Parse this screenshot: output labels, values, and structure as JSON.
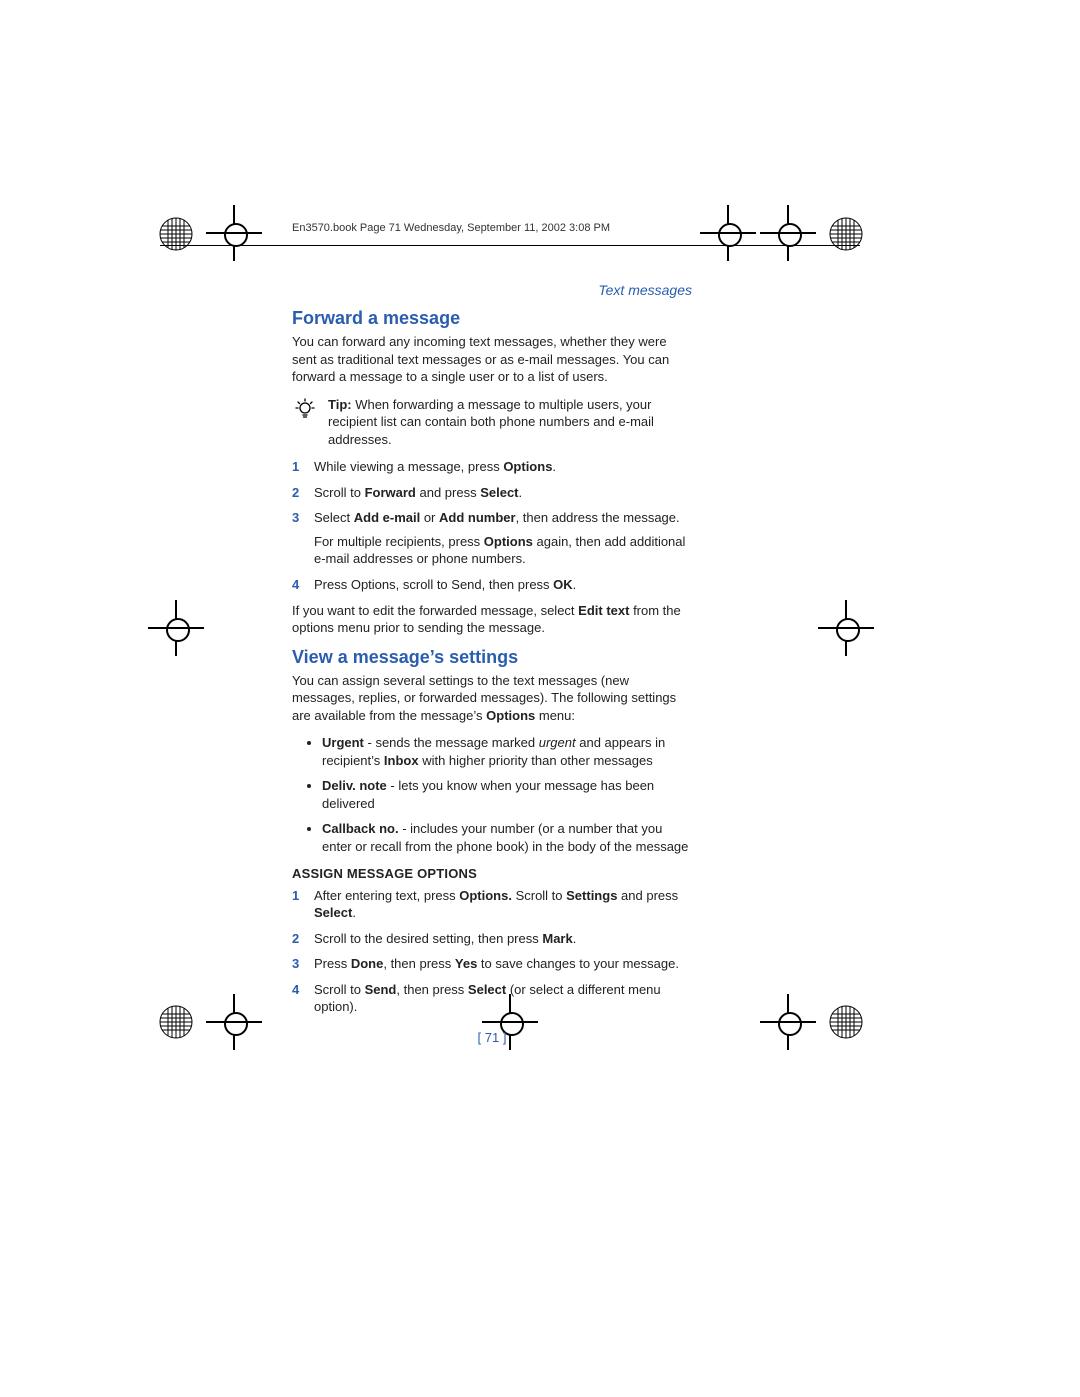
{
  "header": {
    "book_line": "En3570.book  Page 71  Wednesday, September 11, 2002  3:08 PM"
  },
  "section_label": "Text messages",
  "forward": {
    "heading": "Forward a message",
    "intro": "You can forward any incoming text messages, whether they were sent as traditional text messages or as e-mail messages. You can forward a message to a single user or to a list of users.",
    "tip_html": "<b>Tip:</b>  When forwarding a message to multiple users, your recipient list can contain both phone numbers and e-mail addresses.",
    "steps": [
      "While viewing a message, press <b>Options</b>.",
      "Scroll to <b>Forward</b> and press <b>Select</b>.",
      "Select <b>Add e-mail</b> or <b>Add number</b>, then address the message.<div class=\"sub\">For multiple recipients, press <b>Options</b> again, then add additional e-mail addresses or phone numbers.</div>",
      "Press Options, scroll to Send, then press <b>OK</b>."
    ],
    "outro": "If you want to edit the forwarded message, select <b>Edit text</b> from the options menu prior to sending the message."
  },
  "view": {
    "heading": "View a message’s settings",
    "intro_html": "You can assign several settings to the text messages (new messages, replies, or forwarded messages). The following settings are available from the message’s <b>Options</b> menu:",
    "bullets": [
      "<b>Urgent</b> - sends the message marked <i>urgent</i> and appears in recipient’s <b>Inbox</b> with higher priority than other messages",
      "<b>Deliv. note</b> - lets you know when your message has been delivered",
      "<b>Callback no.</b> - includes your number (or a number that you enter or recall from the phone book) in the body of the message"
    ],
    "subhead": "ASSIGN MESSAGE OPTIONS",
    "steps": [
      "After entering text, press <b>Options.</b> Scroll to <b>Settings</b> and press <b>Select</b>.",
      "Scroll to the desired setting, then press <b>Mark</b>.",
      "Press <b>Done</b>, then press <b>Yes</b> to save changes to your message.",
      "Scroll to <b>Send</b>, then press <b>Select</b> (or select a different menu option)."
    ]
  },
  "page_number": "[ 71 ]",
  "icons": {
    "tip_glyph": "💡"
  }
}
